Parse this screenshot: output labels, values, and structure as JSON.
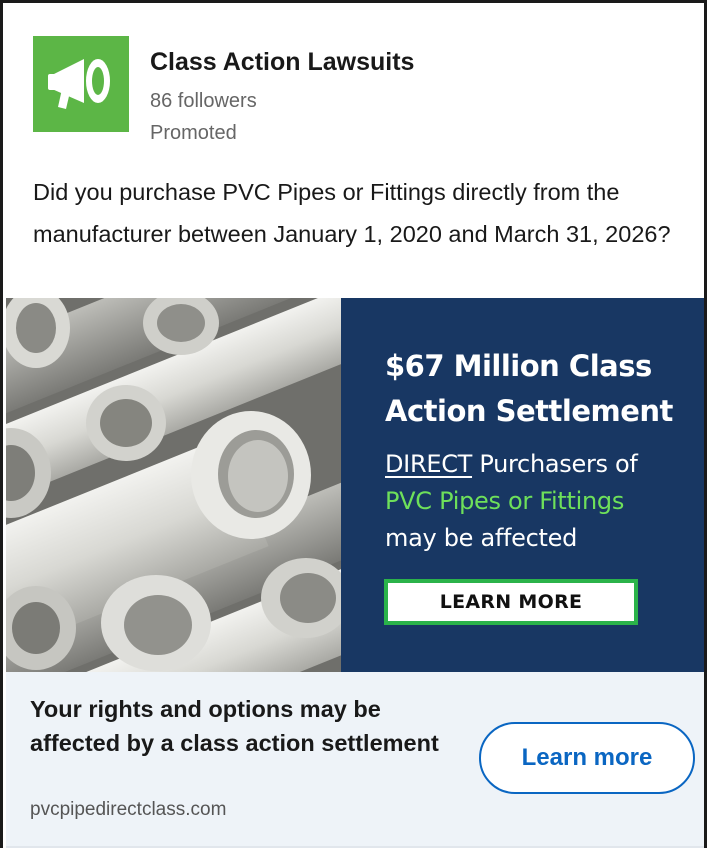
{
  "colors": {
    "logo_bg": "#5cb646",
    "ad_panel_bg": "#183763",
    "ad_highlight_green": "#6ee05a",
    "cta_border": "#2bb34a",
    "link_blue": "#0a66c2",
    "footer_bg": "#eef3f8"
  },
  "header": {
    "logo_icon": "megaphone-icon",
    "company_name": "Class Action Lawsuits",
    "followers": "86 followers",
    "promoted": "Promoted"
  },
  "post": {
    "text": "Did you purchase PVC Pipes or Fittings directly from the manufacturer between January 1, 2020 and March 31, 2026?"
  },
  "ad": {
    "title": "$67 Million Class Action Settlement",
    "sub_direct": "DIRECT",
    "sub_rest": " Purchasers of",
    "sub_green": "PVC Pipes or Fittings",
    "sub_end": "may be affected",
    "cta_label": "LEARN MORE"
  },
  "footer": {
    "headline": "Your rights and options may be affected by a class action settlement",
    "domain": "pvcpipedirectclass.com",
    "button_label": "Learn more"
  }
}
